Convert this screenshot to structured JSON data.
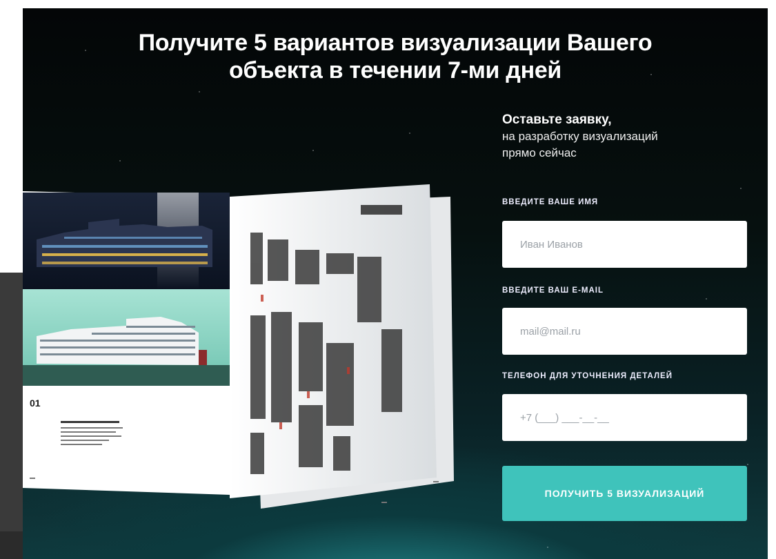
{
  "headline": {
    "line1": "Получите 5 вариантов визуализации Вашего",
    "line2": "объекта в течении 7-ми дней"
  },
  "form": {
    "title": "Оставьте заявку,",
    "subtitle_line1": "на разработку визуализаций",
    "subtitle_line2": "прямо сейчас",
    "name_label": "ВВЕДИТЕ ВАШЕ ИМЯ",
    "name_placeholder": "Иван Иванов",
    "email_label": "ВВЕДИТЕ ВАШ E-MAIL",
    "email_placeholder": "mail@mail.ru",
    "phone_label": "ТЕЛЕФОН ДЛЯ УТОЧНЕНИЯ ДЕТАЛЕЙ",
    "phone_placeholder": "+7 (___) ___-__-__",
    "submit_label": "ПОЛУЧИТЬ 5 ВИЗУАЛИЗАЦИЙ"
  },
  "brochure": {
    "page_number": "01",
    "colors": {
      "accent": "#3fc3bb",
      "building_green": "#8fd6c6",
      "night": "#0d1a24"
    }
  }
}
